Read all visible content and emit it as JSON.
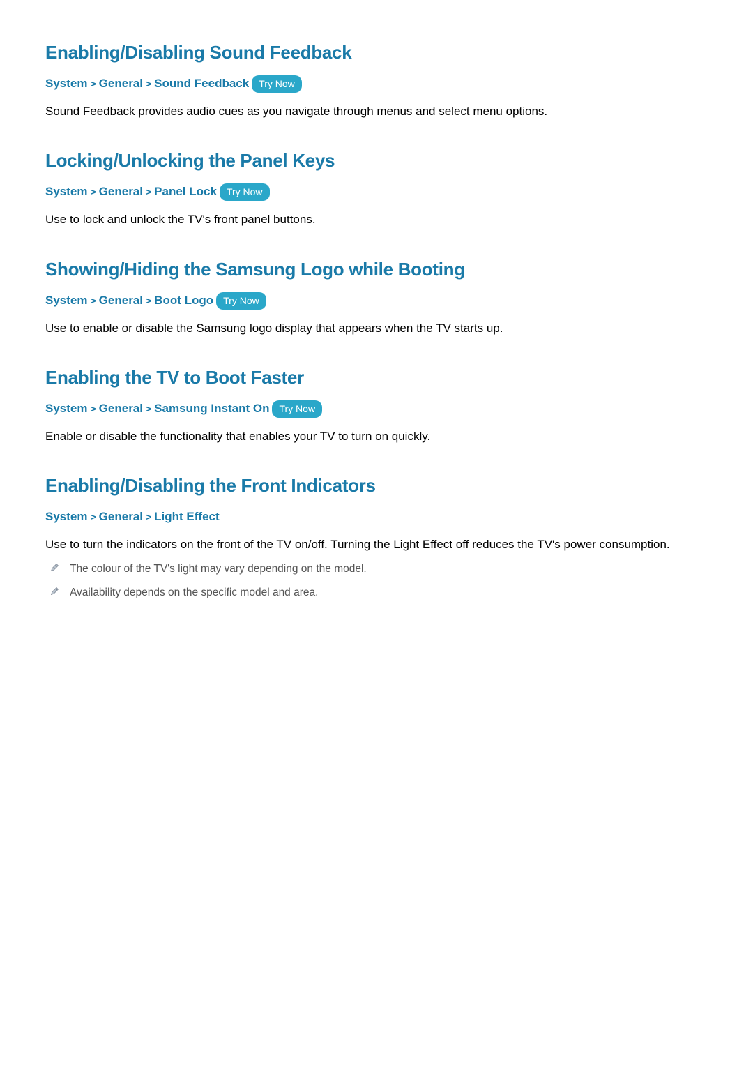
{
  "try_now_label": "Try Now",
  "sections": [
    {
      "title": "Enabling/Disabling Sound Feedback",
      "breadcrumb": [
        "System",
        "General",
        "Sound Feedback"
      ],
      "has_try_now": true,
      "body": "Sound Feedback provides audio cues as you navigate through menus and select menu options.",
      "notes": []
    },
    {
      "title": "Locking/Unlocking the Panel Keys",
      "breadcrumb": [
        "System",
        "General",
        "Panel Lock"
      ],
      "has_try_now": true,
      "body": "Use to lock and unlock the TV's front panel buttons.",
      "notes": []
    },
    {
      "title": "Showing/Hiding the Samsung Logo while Booting",
      "breadcrumb": [
        "System",
        "General",
        "Boot Logo"
      ],
      "has_try_now": true,
      "body": "Use to enable or disable the Samsung logo display that appears when the TV starts up.",
      "notes": []
    },
    {
      "title": "Enabling the TV to Boot Faster",
      "breadcrumb": [
        "System",
        "General",
        "Samsung Instant On"
      ],
      "has_try_now": true,
      "body": "Enable or disable the functionality that enables your TV to turn on quickly.",
      "notes": []
    },
    {
      "title": "Enabling/Disabling the Front Indicators",
      "breadcrumb": [
        "System",
        "General",
        "Light Effect"
      ],
      "has_try_now": false,
      "body": "Use to turn the indicators on the front of the TV on/off. Turning the Light Effect off reduces the TV's power consumption.",
      "notes": [
        "The colour of the TV's light may vary depending on the model.",
        "Availability depends on the specific model and area."
      ]
    }
  ]
}
